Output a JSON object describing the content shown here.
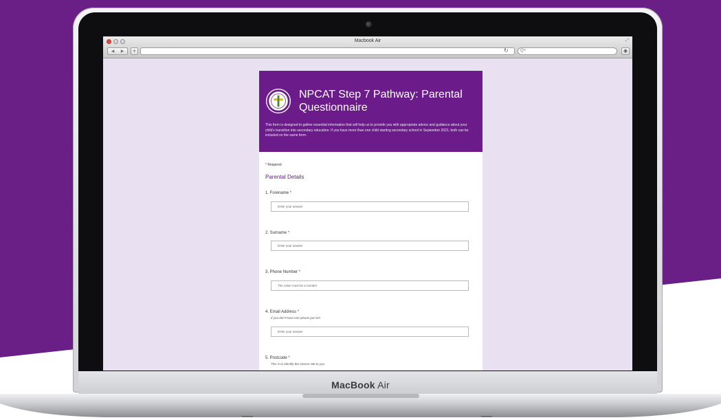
{
  "browser": {
    "window_title": "Macbook Air",
    "search_placeholder": "Q˅",
    "reload_symbol": "↻",
    "back_forward": [
      "◀",
      "▶"
    ],
    "new_tab": "+"
  },
  "laptop": {
    "brand_bold": "MacBook",
    "brand_rest": " Air"
  },
  "form": {
    "title": "NPCAT Step 7 Pathway: Parental Questionnaire",
    "description": "This form is designed to gather essential information that will help us to provide you with appropriate advice and guidance about your child's transition into secondary education. If you have more than one child starting secondary school in September 2021, both can be included on the same form.",
    "required_star": "*",
    "required_label": "Required",
    "section": "Parental Details",
    "questions": [
      {
        "label": "1. Forename",
        "placeholder": "Enter your answer"
      },
      {
        "label": "2. Surname",
        "placeholder": "Enter your answer"
      },
      {
        "label": "3. Phone Number",
        "placeholder": "The value must be a number"
      },
      {
        "label": "4. Email Address",
        "hint": "If you don't have one please put N/A",
        "placeholder": "Enter your answer"
      },
      {
        "label": "5. Postcode",
        "hint": "This is to identify the closest site to you"
      }
    ]
  },
  "colors": {
    "brand_purple": "#6b1c8a",
    "page_bg": "#e9e1f2",
    "required_red": "#c8102e"
  }
}
